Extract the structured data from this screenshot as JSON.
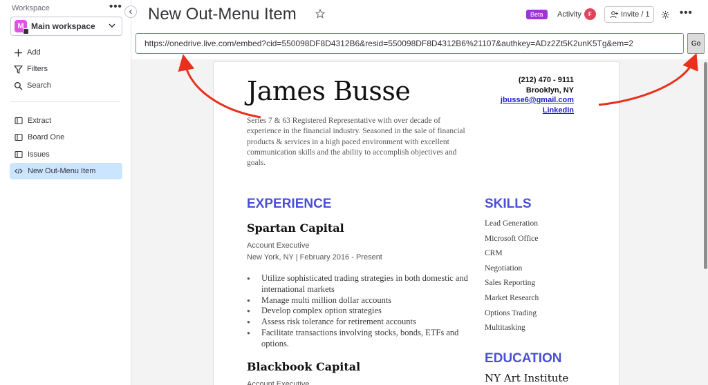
{
  "sidebar": {
    "workspace_label": "Workspace",
    "workspace_more": "•••",
    "workspace_avatar": "M",
    "workspace_name": "Main workspace",
    "actions": [
      {
        "label": "Add",
        "icon": "plus-icon"
      },
      {
        "label": "Filters",
        "icon": "filter-icon"
      },
      {
        "label": "Search",
        "icon": "search-icon"
      }
    ],
    "boards": [
      {
        "label": "Extract",
        "icon": "board-icon",
        "active": false
      },
      {
        "label": "Board One",
        "icon": "board-icon",
        "active": false
      },
      {
        "label": "Issues",
        "icon": "board-icon",
        "active": false
      },
      {
        "label": "New Out-Menu Item",
        "icon": "code-icon",
        "active": true
      }
    ]
  },
  "header": {
    "title": "New Out-Menu Item",
    "beta_label": "Beta",
    "activity_label": "Activity",
    "activity_avatar": "F",
    "invite_label": "Invite / 1",
    "more": "•••"
  },
  "url_bar": {
    "value": "https://onedrive.live.com/embed?cid=550098DF8D4312B6&resid=550098DF8D4312B6%21107&authkey=ADz2Zt5K2unK5Tg&em=2",
    "go_label": "Go"
  },
  "resume": {
    "name": "James Busse",
    "phone": "(212) 470 - 9111",
    "location": "Brooklyn, NY",
    "email": "jbusse6@gmail.com",
    "linkedin": "LinkedIn",
    "summary": "Series 7 & 63 Registered Representative with over decade of experience in the financial industry. Seasoned in the sale of financial products & services in a high paced environment with excellent communication skills and the ability to accomplish objectives and goals.",
    "experience_title": "EXPERIENCE",
    "jobs": [
      {
        "company": "Spartan Capital",
        "role": "Account Executive",
        "location_dates": "New York, NY | February 2016 - Present",
        "bullets": [
          "Utilize sophisticated trading strategies in both domestic and international markets",
          "Manage multi million dollar accounts",
          "Develop complex option strategies",
          "Assess risk tolerance for retirement accounts",
          "Facilitate transactions involving stocks, bonds, ETFs and options."
        ]
      },
      {
        "company": "Blackbook Capital",
        "role": "Account Executive"
      }
    ],
    "skills_title": "SKILLS",
    "skills": [
      "Lead Generation",
      "Microsoft Office",
      "CRM",
      "Negotiation",
      "Sales Reporting",
      "Market Research",
      "Options Trading",
      "Multitasking"
    ],
    "education_title": "EDUCATION",
    "school": "NY Art Institute"
  },
  "colors": {
    "accent": "#4a4ed8",
    "active_item": "#cce5ff",
    "beta": "#9d34da",
    "annotation_arrow": "#e8301c"
  }
}
